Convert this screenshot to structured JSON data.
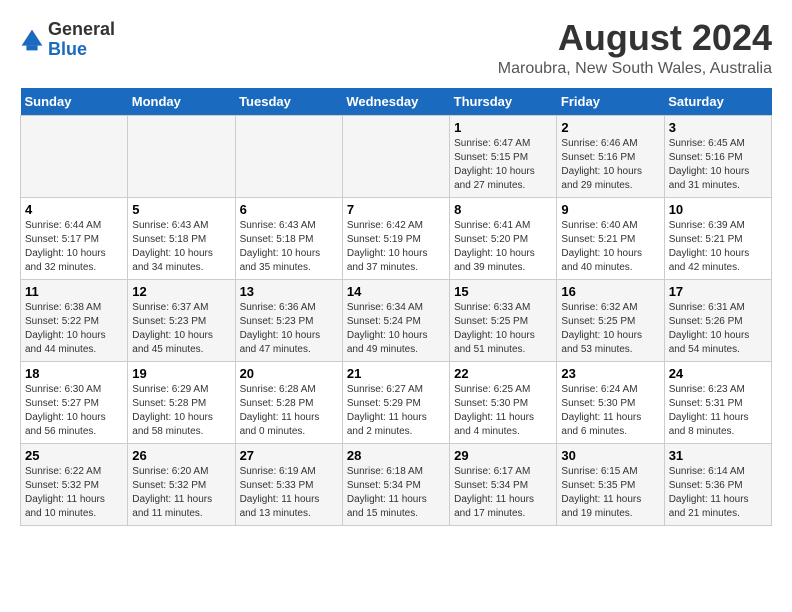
{
  "header": {
    "logo_general": "General",
    "logo_blue": "Blue",
    "month_year": "August 2024",
    "location": "Maroubra, New South Wales, Australia"
  },
  "days_of_week": [
    "Sunday",
    "Monday",
    "Tuesday",
    "Wednesday",
    "Thursday",
    "Friday",
    "Saturday"
  ],
  "weeks": [
    [
      {
        "day": "",
        "info": ""
      },
      {
        "day": "",
        "info": ""
      },
      {
        "day": "",
        "info": ""
      },
      {
        "day": "",
        "info": ""
      },
      {
        "day": "1",
        "info": "Sunrise: 6:47 AM\nSunset: 5:15 PM\nDaylight: 10 hours\nand 27 minutes."
      },
      {
        "day": "2",
        "info": "Sunrise: 6:46 AM\nSunset: 5:16 PM\nDaylight: 10 hours\nand 29 minutes."
      },
      {
        "day": "3",
        "info": "Sunrise: 6:45 AM\nSunset: 5:16 PM\nDaylight: 10 hours\nand 31 minutes."
      }
    ],
    [
      {
        "day": "4",
        "info": "Sunrise: 6:44 AM\nSunset: 5:17 PM\nDaylight: 10 hours\nand 32 minutes."
      },
      {
        "day": "5",
        "info": "Sunrise: 6:43 AM\nSunset: 5:18 PM\nDaylight: 10 hours\nand 34 minutes."
      },
      {
        "day": "6",
        "info": "Sunrise: 6:43 AM\nSunset: 5:18 PM\nDaylight: 10 hours\nand 35 minutes."
      },
      {
        "day": "7",
        "info": "Sunrise: 6:42 AM\nSunset: 5:19 PM\nDaylight: 10 hours\nand 37 minutes."
      },
      {
        "day": "8",
        "info": "Sunrise: 6:41 AM\nSunset: 5:20 PM\nDaylight: 10 hours\nand 39 minutes."
      },
      {
        "day": "9",
        "info": "Sunrise: 6:40 AM\nSunset: 5:21 PM\nDaylight: 10 hours\nand 40 minutes."
      },
      {
        "day": "10",
        "info": "Sunrise: 6:39 AM\nSunset: 5:21 PM\nDaylight: 10 hours\nand 42 minutes."
      }
    ],
    [
      {
        "day": "11",
        "info": "Sunrise: 6:38 AM\nSunset: 5:22 PM\nDaylight: 10 hours\nand 44 minutes."
      },
      {
        "day": "12",
        "info": "Sunrise: 6:37 AM\nSunset: 5:23 PM\nDaylight: 10 hours\nand 45 minutes."
      },
      {
        "day": "13",
        "info": "Sunrise: 6:36 AM\nSunset: 5:23 PM\nDaylight: 10 hours\nand 47 minutes."
      },
      {
        "day": "14",
        "info": "Sunrise: 6:34 AM\nSunset: 5:24 PM\nDaylight: 10 hours\nand 49 minutes."
      },
      {
        "day": "15",
        "info": "Sunrise: 6:33 AM\nSunset: 5:25 PM\nDaylight: 10 hours\nand 51 minutes."
      },
      {
        "day": "16",
        "info": "Sunrise: 6:32 AM\nSunset: 5:25 PM\nDaylight: 10 hours\nand 53 minutes."
      },
      {
        "day": "17",
        "info": "Sunrise: 6:31 AM\nSunset: 5:26 PM\nDaylight: 10 hours\nand 54 minutes."
      }
    ],
    [
      {
        "day": "18",
        "info": "Sunrise: 6:30 AM\nSunset: 5:27 PM\nDaylight: 10 hours\nand 56 minutes."
      },
      {
        "day": "19",
        "info": "Sunrise: 6:29 AM\nSunset: 5:28 PM\nDaylight: 10 hours\nand 58 minutes."
      },
      {
        "day": "20",
        "info": "Sunrise: 6:28 AM\nSunset: 5:28 PM\nDaylight: 11 hours\nand 0 minutes."
      },
      {
        "day": "21",
        "info": "Sunrise: 6:27 AM\nSunset: 5:29 PM\nDaylight: 11 hours\nand 2 minutes."
      },
      {
        "day": "22",
        "info": "Sunrise: 6:25 AM\nSunset: 5:30 PM\nDaylight: 11 hours\nand 4 minutes."
      },
      {
        "day": "23",
        "info": "Sunrise: 6:24 AM\nSunset: 5:30 PM\nDaylight: 11 hours\nand 6 minutes."
      },
      {
        "day": "24",
        "info": "Sunrise: 6:23 AM\nSunset: 5:31 PM\nDaylight: 11 hours\nand 8 minutes."
      }
    ],
    [
      {
        "day": "25",
        "info": "Sunrise: 6:22 AM\nSunset: 5:32 PM\nDaylight: 11 hours\nand 10 minutes."
      },
      {
        "day": "26",
        "info": "Sunrise: 6:20 AM\nSunset: 5:32 PM\nDaylight: 11 hours\nand 11 minutes."
      },
      {
        "day": "27",
        "info": "Sunrise: 6:19 AM\nSunset: 5:33 PM\nDaylight: 11 hours\nand 13 minutes."
      },
      {
        "day": "28",
        "info": "Sunrise: 6:18 AM\nSunset: 5:34 PM\nDaylight: 11 hours\nand 15 minutes."
      },
      {
        "day": "29",
        "info": "Sunrise: 6:17 AM\nSunset: 5:34 PM\nDaylight: 11 hours\nand 17 minutes."
      },
      {
        "day": "30",
        "info": "Sunrise: 6:15 AM\nSunset: 5:35 PM\nDaylight: 11 hours\nand 19 minutes."
      },
      {
        "day": "31",
        "info": "Sunrise: 6:14 AM\nSunset: 5:36 PM\nDaylight: 11 hours\nand 21 minutes."
      }
    ]
  ]
}
